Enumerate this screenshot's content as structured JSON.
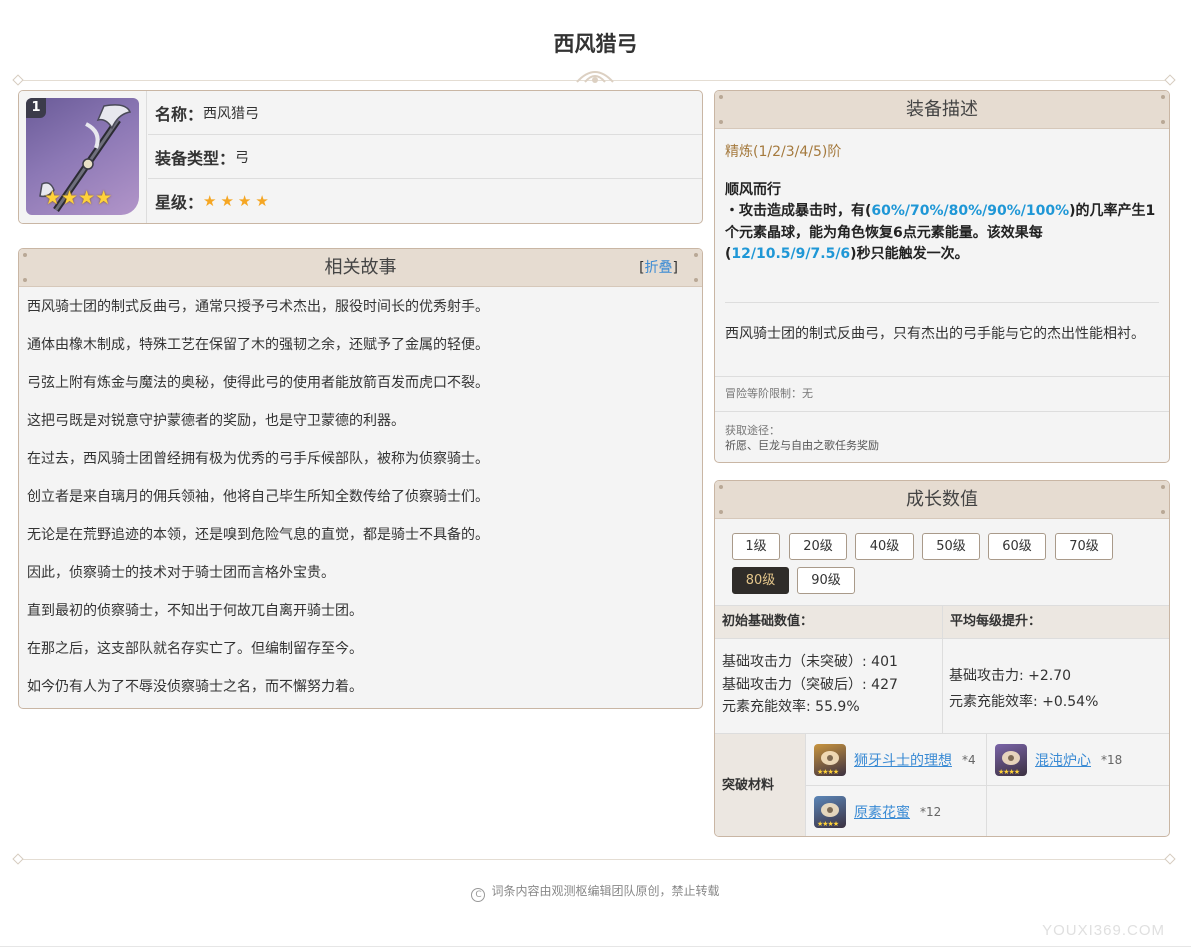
{
  "page": {
    "title": "西风猎弓"
  },
  "weapon": {
    "refine_level": "1",
    "rarity_stars": 4,
    "name_label": "名称：",
    "name_value": "西风猎弓",
    "type_label": "装备类型：",
    "type_value": "弓",
    "rank_label": "星级：",
    "icon_name": "bow-icon"
  },
  "story": {
    "title": "相关故事",
    "toggle_open": "[",
    "toggle_label": "折叠",
    "toggle_close": "]",
    "lines": [
      "西风骑士团的制式反曲弓，通常只授予弓术杰出，服役时间长的优秀射手。",
      "通体由橡木制成，特殊工艺在保留了木的强韧之余，还赋予了金属的轻便。",
      "弓弦上附有炼金与魔法的奥秘，使得此弓的使用者能放箭百发而虎口不裂。",
      "这把弓既是对锐意守护蒙德者的奖励，也是守卫蒙德的利器。",
      "在过去，西风骑士团曾经拥有极为优秀的弓手斥候部队，被称为侦察骑士。",
      "创立者是来自璃月的佣兵领袖，他将自己毕生所知全数传给了侦察骑士们。",
      "无论是在荒野追迹的本领，还是嗅到危险气息的直觉，都是骑士不具备的。",
      "因此，侦察骑士的技术对于骑士团而言格外宝贵。",
      "直到最初的侦察骑士，不知出于何故兀自离开骑士团。",
      "在那之后，这支部队就名存实亡了。但编制留存至今。",
      "如今仍有人为了不辱没侦察骑士之名，而不懈努力着。"
    ]
  },
  "description": {
    "title": "装备描述",
    "refine_text": "精炼(1/2/3/4/5)阶",
    "skill_name": "顺风而行",
    "skill_part1": "・攻击造成暴击时，有(",
    "skill_hl1": "60%/70%/80%/90%/100%",
    "skill_part2": ")的几率产生1个元素晶球，能为角色恢复6点元素能量。该效果每(",
    "skill_hl2": "12/10.5/9/7.5/6",
    "skill_part3": ")秒只能触发一次。",
    "flavor": "西风骑士团的制式反曲弓，只有杰出的弓手能与它的杰出性能相衬。",
    "ar_limit": "冒险等阶限制：无",
    "obtain_label": "获取途径：",
    "obtain_value": "祈愿、巨龙与自由之歌任务奖励"
  },
  "growth": {
    "title": "成长数值",
    "levels": [
      "1级",
      "20级",
      "40级",
      "50级",
      "60级",
      "70级",
      "80级",
      "90级"
    ],
    "active_level": "80级",
    "base_header": "初始基础数值：",
    "avg_header": "平均每级提升：",
    "base_stats": [
      "基础攻击力（未突破）: 401",
      "基础攻击力（突破后）: 427",
      "元素充能效率: 55.9%"
    ],
    "avg_stats": [
      "基础攻击力: +2.70",
      "元素充能效率: +0.54%"
    ],
    "materials_label": "突破材料",
    "materials": [
      {
        "name": "狮牙斗士的理想",
        "count": "*4",
        "icon": "lion-tooth-icon",
        "color": "#c9953f"
      },
      {
        "name": "混沌炉心",
        "count": "*18",
        "icon": "chaos-core-icon",
        "color": "#7a64a8"
      },
      {
        "name": "原素花蜜",
        "count": "*12",
        "icon": "nectar-icon",
        "color": "#5b86b8"
      }
    ]
  },
  "footer": {
    "copyright_symbol": "C",
    "text": "词条内容由观测枢编辑团队原创，禁止转载",
    "watermark": "YOUXI369.COM"
  },
  "colors": {
    "panel_border": "#c9b6a4",
    "panel_header": "#e6dcd1",
    "highlight": "#1f97d6",
    "refine": "#a57a3e",
    "link": "#3b8bd4",
    "active_tab_bg": "#2f2c29",
    "active_tab_text": "#e3c58a"
  }
}
